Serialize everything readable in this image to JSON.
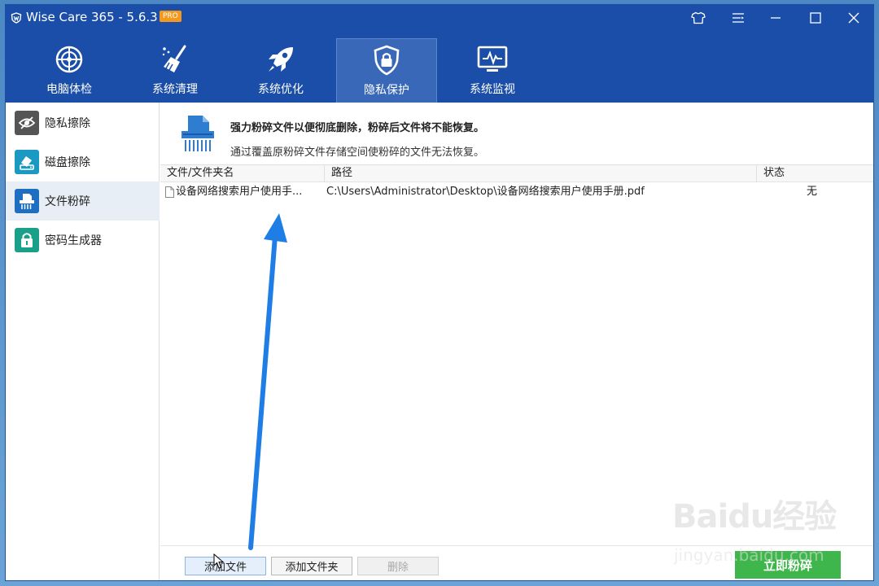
{
  "window": {
    "title": "Wise Care 365 - 5.6.3",
    "badge": "PRO"
  },
  "nav": {
    "tabs": [
      {
        "label": "电脑体检",
        "icon": "radar-icon"
      },
      {
        "label": "系统清理",
        "icon": "broom-icon"
      },
      {
        "label": "系统优化",
        "icon": "rocket-icon"
      },
      {
        "label": "隐私保护",
        "icon": "shield-lock-icon",
        "active": true
      },
      {
        "label": "系统监视",
        "icon": "monitor-pulse-icon"
      }
    ]
  },
  "sidebar": {
    "items": [
      {
        "label": "隐私擦除",
        "icon": "eye-slash-icon",
        "color": "#555555"
      },
      {
        "label": "磁盘擦除",
        "icon": "disk-eraser-icon",
        "color": "#1a9ac2"
      },
      {
        "label": "文件粉碎",
        "icon": "shredder-icon",
        "color": "#1e6fc2",
        "active": true
      },
      {
        "label": "密码生成器",
        "icon": "lock-icon",
        "color": "#1aa089"
      }
    ]
  },
  "main": {
    "title": "强力粉碎文件以便彻底删除，粉碎后文件将不能恢复。",
    "description": "通过覆盖原粉碎文件存储空间使粉碎的文件无法恢复。",
    "table": {
      "columns": [
        "文件/文件夹名",
        "路径",
        "状态"
      ],
      "rows": [
        {
          "name": "设备网络搜索用户使用手...",
          "path": "C:\\Users\\Administrator\\Desktop\\设备网络搜索用户使用手册.pdf",
          "status": "无"
        }
      ]
    },
    "buttons": {
      "add_file": "添加文件",
      "add_folder": "添加文件夹",
      "delete": "删除",
      "shred_now": "立即粉碎"
    }
  },
  "watermark": {
    "brand": "Baidu经验",
    "url": "jingyan.baidu.com"
  },
  "colors": {
    "titlebar": "#1b4ea8",
    "active_tab": "#3a68b8",
    "shred_button": "#3fb64b",
    "annotation_arrow": "#1e7ee6"
  }
}
